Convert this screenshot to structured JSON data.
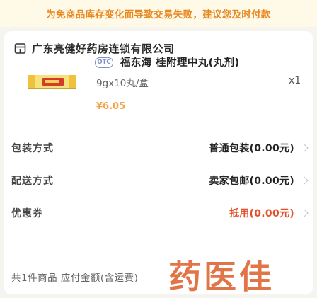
{
  "notice": {
    "text": "为免商品库存变化而导致交易失败，建议您及时付款"
  },
  "store": {
    "name": "广东亮健好药房连锁有限公司",
    "icon": "store-icon"
  },
  "product": {
    "otc_badge": "OTC",
    "name": "福东海 桂附理中丸(丸剂)",
    "spec": "9gx10丸/盒",
    "quantity": "x1",
    "price": "¥6.05"
  },
  "rows": {
    "packaging": {
      "label": "包装方式",
      "value": "普通包装(0.00元)"
    },
    "delivery": {
      "label": "配送方式",
      "value": "卖家包邮(0.00元)"
    },
    "coupon": {
      "label": "优惠券",
      "value": "抵用(0.00元)"
    }
  },
  "footer": {
    "text": "共1件商品 应付金额(含运费)"
  },
  "watermark": {
    "text": "药医佳"
  },
  "colors": {
    "accent": "#e8871e",
    "coupon": "#e2502b",
    "price": "#f2a64a",
    "otc": "#7f90c6"
  }
}
